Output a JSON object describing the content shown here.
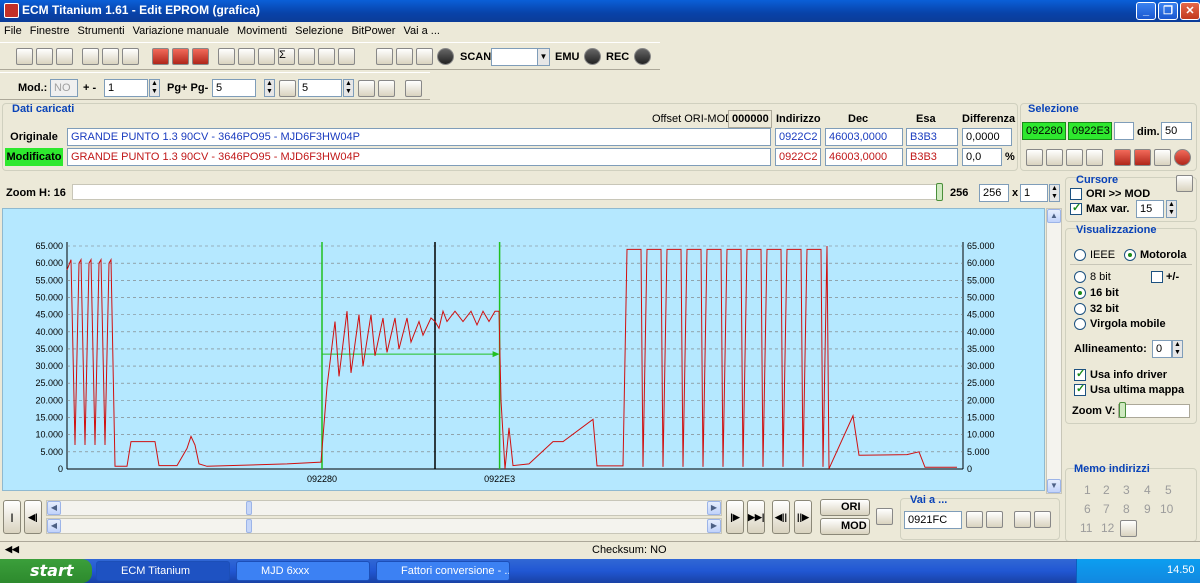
{
  "window": {
    "title": "ECM Titanium 1.61 - Edit EPROM (grafica)"
  },
  "menu": [
    "File",
    "Finestre",
    "Strumenti",
    "Variazione manuale",
    "Movimenti",
    "Selezione",
    "BitPower",
    "Vai a ..."
  ],
  "toolbar1": {
    "scan_label": "SCAN",
    "emu_label": "EMU",
    "rec_label": "REC",
    "scan_value": ""
  },
  "toolbar2": {
    "mod_label": "Mod.:",
    "mod_value": "NO",
    "plusminus_label": "+ -",
    "plusminus_value": "1",
    "pg_label": "Pg+ Pg-",
    "pg_value": "5",
    "p_value": "5"
  },
  "dati": {
    "title": "Dati caricati",
    "offset_label": "Offset ORI-MOD",
    "offset_value": "000000",
    "headers": {
      "indirizzo": "Indirizzo",
      "dec": "Dec",
      "esa": "Esa",
      "differenza": "Differenza"
    },
    "originale": {
      "label": "Originale",
      "name": "GRANDE PUNTO 1.3 90CV - 3646PO95 - MJD6F3HW04P",
      "indirizzo": "0922C2",
      "dec": "46003,0000",
      "esa": "B3B3",
      "diff": "0,0000"
    },
    "modificato": {
      "label": "Modificato",
      "name": "GRANDE PUNTO 1.3 90CV - 3646PO95 - MJD6F3HW04P",
      "indirizzo": "0922C2",
      "dec": "46003,0000",
      "esa": "B3B3",
      "diff": "0,0",
      "diff_unit": "%"
    }
  },
  "selezione": {
    "title": "Selezione",
    "start": "092280",
    "end": "0922E3",
    "extra": "",
    "dim_label": "dim.",
    "dim_value": "50"
  },
  "zoom": {
    "label": "Zoom H: 16",
    "value_label": "256",
    "value": "256",
    "mult_label": "x",
    "mult": "1"
  },
  "cursore": {
    "title": "Cursore",
    "ori_mod_label": "ORI >> MOD",
    "ori_mod_checked": false,
    "maxvar_label": "Max var.",
    "maxvar_checked": true,
    "maxvar_value": "15"
  },
  "visualizzazione": {
    "title": "Visualizzazione",
    "ieee": "IEEE",
    "motorola": "Motorola",
    "bit8": "8 bit",
    "plusminus": "+/-",
    "bit16": "16 bit",
    "bit32": "32 bit",
    "virgola": "Virgola mobile",
    "allineamento_label": "Allineamento:",
    "allineamento_value": "0",
    "usa_info_driver": "Usa info driver",
    "usa_ultima_mappa": "Usa ultima mappa",
    "zoomv_label": "Zoom V:"
  },
  "memo": {
    "title": "Memo indirizzi",
    "numbers": [
      "1",
      "2",
      "3",
      "4",
      "5",
      "6",
      "7",
      "8",
      "9",
      "10",
      "11",
      "12"
    ]
  },
  "bottom": {
    "ori_label": "ORI",
    "mod_label": "MOD",
    "vai_title": "Vai a ...",
    "vai_value": "0921FC"
  },
  "status": {
    "checksum": "Checksum: NO"
  },
  "taskbar": {
    "start": "start",
    "tasks": [
      "ECM Titanium",
      "MJD 6xxx",
      "Fattori conversione - ..."
    ],
    "clock": "14.50"
  },
  "chart_data": {
    "type": "line",
    "y_ticks": [
      "65.000",
      "60.000",
      "55.000",
      "50.000",
      "45.000",
      "40.000",
      "35.000",
      "30.000",
      "25.000",
      "20.000",
      "15.000",
      "10.000",
      "5.000",
      "0"
    ],
    "ylim": [
      0,
      65000
    ],
    "xlim": [
      0,
      256
    ],
    "x_tick_labels": [
      {
        "label": "092280",
        "x": 64
      },
      {
        "label": "0922E3",
        "x": 163
      }
    ],
    "selection_start": 64,
    "selection_end": 163,
    "cursor": 113,
    "max_var_arrow": {
      "x1": 64,
      "x2": 163,
      "y": 33500
    },
    "series": [
      {
        "color": "#d01010",
        "points": [
          [
            0,
            58000
          ],
          [
            2,
            61000
          ],
          [
            4,
            7000
          ],
          [
            6,
            60000
          ],
          [
            7,
            61000
          ],
          [
            9,
            7000
          ],
          [
            11,
            60000
          ],
          [
            12,
            61000
          ],
          [
            14,
            7000
          ],
          [
            16,
            60000
          ],
          [
            17,
            61000
          ],
          [
            19,
            7000
          ],
          [
            21,
            60000
          ],
          [
            22,
            61000
          ],
          [
            24,
            800
          ],
          [
            30,
            800
          ],
          [
            32,
            8000
          ],
          [
            44,
            8000
          ],
          [
            46,
            1000
          ],
          [
            55,
            1000
          ],
          [
            60,
            6000
          ],
          [
            62,
            9500
          ],
          [
            64,
            7000
          ],
          [
            66,
            1500
          ],
          [
            70,
            800
          ],
          [
            110,
            1500
          ],
          [
            127,
            2000
          ],
          [
            130,
            24000
          ],
          [
            134,
            43000
          ],
          [
            136,
            27000
          ],
          [
            140,
            46000
          ],
          [
            142,
            28000
          ],
          [
            146,
            45000
          ],
          [
            148,
            30000
          ],
          [
            152,
            45000
          ],
          [
            154,
            33000
          ],
          [
            158,
            44000
          ],
          [
            160,
            34000
          ],
          [
            164,
            44000
          ],
          [
            166,
            35000
          ],
          [
            170,
            44000
          ],
          [
            172,
            37000
          ],
          [
            176,
            43000
          ],
          [
            178,
            39000
          ],
          [
            182,
            44000
          ],
          [
            184,
            43000
          ],
          [
            186,
            41000
          ],
          [
            188,
            46000
          ],
          [
            190,
            43000
          ],
          [
            194,
            46000
          ],
          [
            198,
            43000
          ],
          [
            202,
            46000
          ],
          [
            205,
            42000
          ],
          [
            208,
            46000
          ],
          [
            211,
            43000
          ],
          [
            214,
            46000
          ],
          [
            216,
            46000
          ],
          [
            217,
            20000
          ],
          [
            219,
            0
          ],
          [
            221,
            12000
          ],
          [
            223,
            1000
          ],
          [
            231,
            1500
          ],
          [
            243,
            8000
          ],
          [
            248,
            8000
          ],
          [
            263,
            14500
          ],
          [
            265,
            900
          ],
          [
            278,
            900
          ],
          [
            280,
            64000
          ],
          [
            287,
            64000
          ],
          [
            288,
            600
          ],
          [
            290,
            64000
          ],
          [
            297,
            64000
          ],
          [
            298,
            600
          ],
          [
            300,
            64000
          ],
          [
            307,
            64000
          ],
          [
            308,
            600
          ],
          [
            310,
            64000
          ],
          [
            317,
            64000
          ],
          [
            318,
            600
          ],
          [
            320,
            64000
          ],
          [
            327,
            64000
          ],
          [
            328,
            600
          ],
          [
            330,
            64000
          ],
          [
            337,
            64000
          ],
          [
            338,
            600
          ],
          [
            340,
            64000
          ],
          [
            347,
            64000
          ],
          [
            348,
            600
          ],
          [
            350,
            64000
          ],
          [
            357,
            64000
          ],
          [
            358,
            600
          ],
          [
            360,
            64000
          ],
          [
            367,
            64000
          ],
          [
            368,
            600
          ],
          [
            370,
            64000
          ],
          [
            377,
            64000
          ],
          [
            378,
            600
          ],
          [
            380,
            65000
          ],
          [
            381,
            100
          ],
          [
            393,
            15500
          ],
          [
            396,
            4000
          ],
          [
            420,
            4200
          ],
          [
            426,
            5000
          ],
          [
            429,
            500
          ],
          [
            445,
            500
          ]
        ]
      }
    ]
  }
}
